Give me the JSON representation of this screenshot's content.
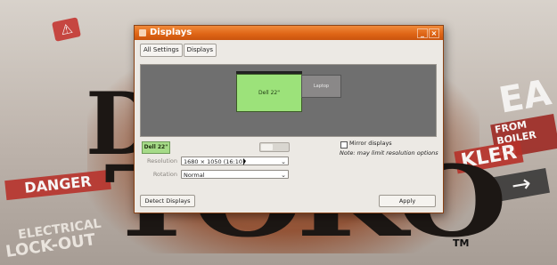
{
  "wallpaper": {
    "danger": "DANGER",
    "electrical": "ELECTRICAL",
    "lockout": "LOCK-OUT",
    "ea": "EA",
    "from_boiler": "FROM BOILER RM",
    "kler": "KLER",
    "arrow": "→",
    "logo_d": "D",
    "logo": "TOKO",
    "tm": "TM"
  },
  "window": {
    "title": "Displays",
    "icons": {
      "app": "monitor-icon",
      "minimize": "minimize-icon",
      "close": "close-icon"
    },
    "minimize_glyph": "_",
    "close_glyph": "×"
  },
  "toolbar": {
    "all_settings": "All Settings",
    "displays": "Displays"
  },
  "preview": {
    "primary_monitor": "Dell 22\"",
    "secondary_monitor": "Laptop"
  },
  "monitor_panel": {
    "selected_monitor": "Dell 22\"",
    "power_toggle_state": "on",
    "mirror_label": "Mirror displays",
    "mirror_checked": false,
    "mirror_note": "Note: may limit resolution options",
    "resolution_label": "Resolution",
    "resolution_value": "1680 × 1050 (16:10)",
    "rotation_label": "Rotation",
    "rotation_value": "Normal"
  },
  "actions": {
    "detect": "Detect Displays",
    "apply": "Apply"
  },
  "colors": {
    "titlebar": "#de6415",
    "primary_monitor": "#9ce27a",
    "preview_bg": "#6f6f6f",
    "logo_accent": "#a4451b"
  }
}
